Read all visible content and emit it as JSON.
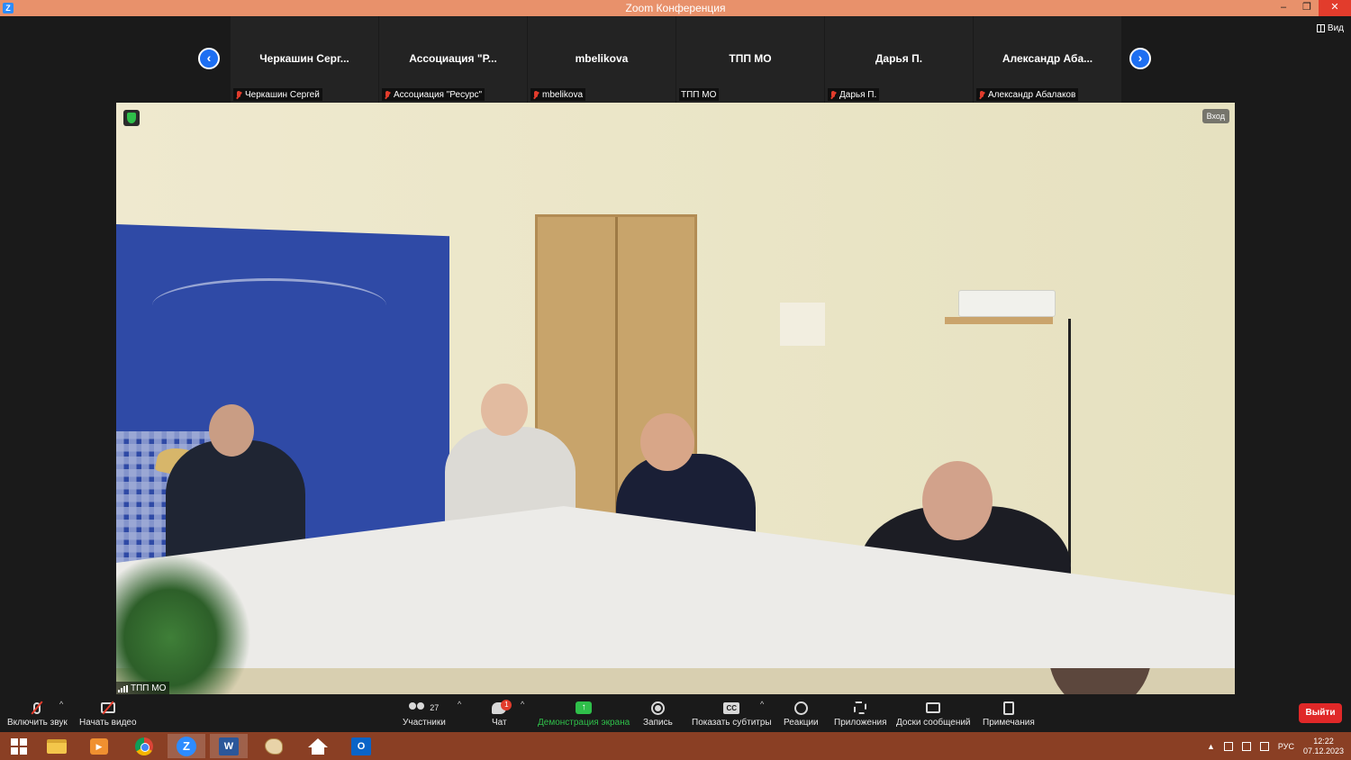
{
  "window": {
    "title": "Zoom Конференция",
    "logo_letter": "Z",
    "minimize": "–",
    "maximize": "❐",
    "close": "✕"
  },
  "gallery": {
    "view_label": "Вид",
    "prev_arrow": "‹",
    "next_arrow": "›",
    "tiles": [
      {
        "name": "Черкашин  Серг...",
        "label": "Черкашин Сергей",
        "muted": true
      },
      {
        "name": "Ассоциация  \"Р...",
        "label": "Ассоциация \"Ресурс\"",
        "muted": true
      },
      {
        "name": "mbelikova",
        "label": "mbelikova",
        "muted": true
      },
      {
        "name": "ТПП МО",
        "label": "ТПП МО",
        "muted": false
      },
      {
        "name": "Дарья П.",
        "label": "Дарья П.",
        "muted": true
      },
      {
        "name": "Александр  Аба...",
        "label": "Александр Абалаков",
        "muted": true
      }
    ]
  },
  "main_video": {
    "speaker_label": "ТПП МО",
    "enter_button": "Вход"
  },
  "toolbar": {
    "unmute": "Включить звук",
    "start_video": "Начать видео",
    "participants": "Участники",
    "participants_count": "27",
    "chat": "Чат",
    "chat_badge": "1",
    "share_screen": "Демонстрация экрана",
    "share_icon": "↑",
    "record": "Запись",
    "captions": "Показать субтитры",
    "captions_icon": "CC",
    "reactions": "Реакции",
    "apps": "Приложения",
    "whiteboards": "Доски сообщений",
    "notes": "Примечания",
    "leave": "Выйти",
    "caret": "^"
  },
  "taskbar": {
    "zoom_letter": "Z",
    "word_letter": "W",
    "outlook_letter": "O",
    "player_letter": "▶",
    "tray_up": "▲",
    "language": "РУС",
    "time": "12:22",
    "date": "07.12.2023"
  },
  "colors": {
    "title_bar": "#e8916b",
    "taskbar": "#8a3f24",
    "zoom_blue": "#2d8cff",
    "leave_red": "#e02828",
    "share_green": "#2fbf4a"
  }
}
